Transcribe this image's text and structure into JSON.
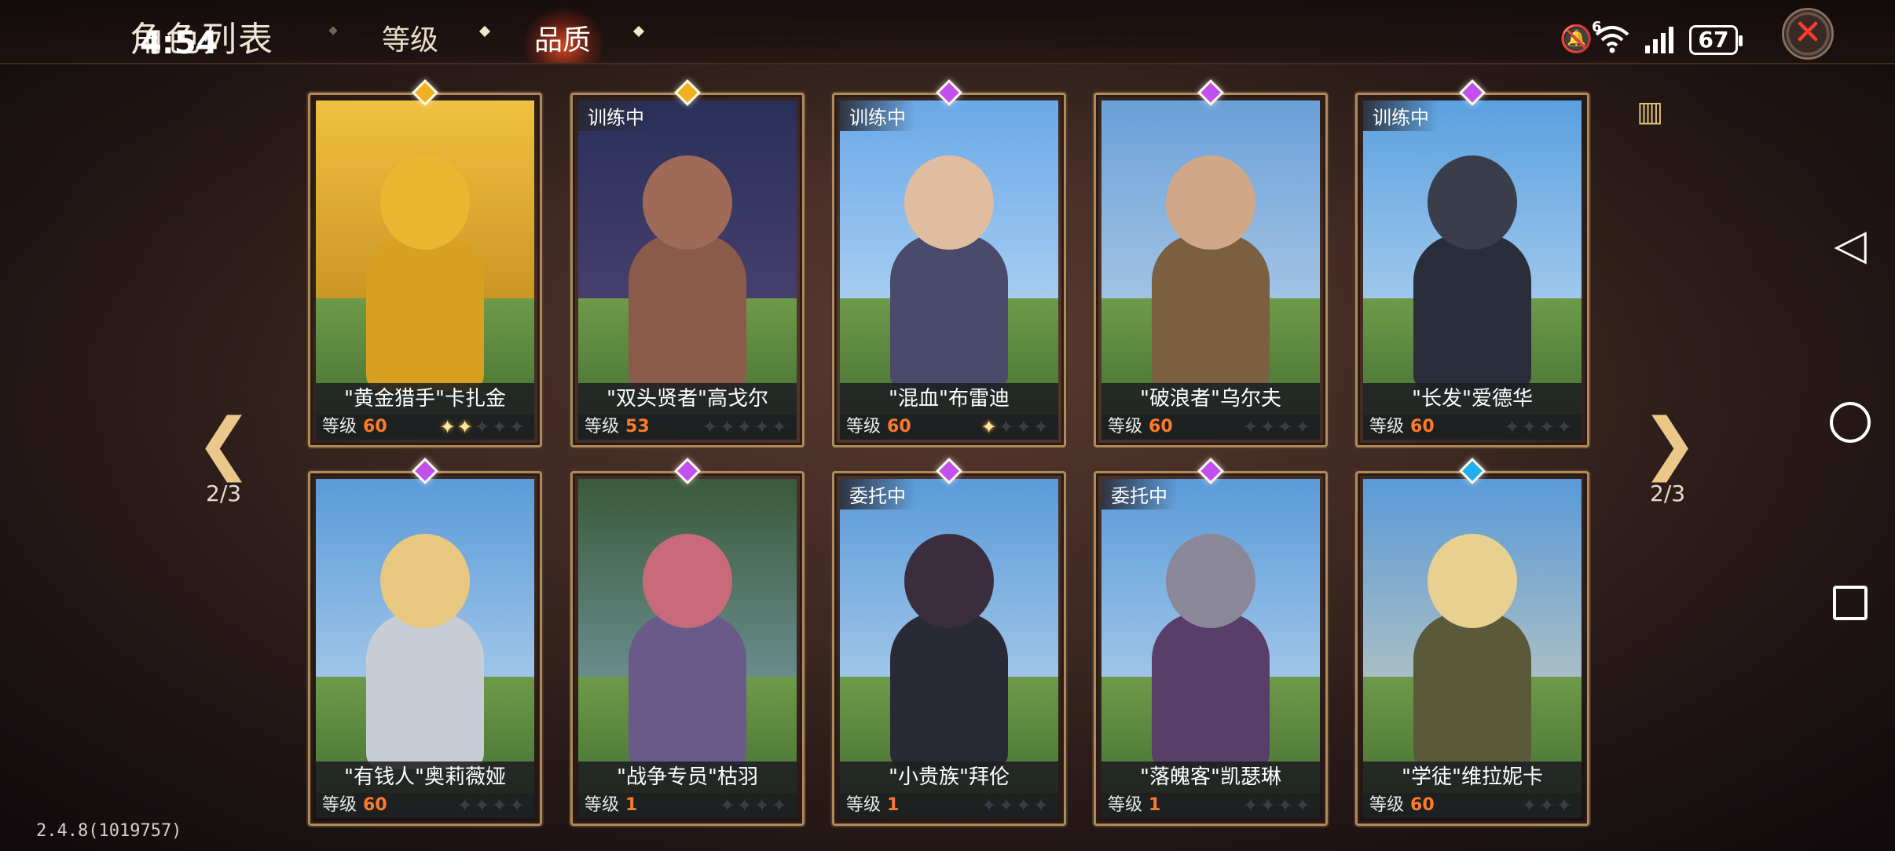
{
  "header": {
    "title": "角色列表",
    "clock": "4:54",
    "tabs": [
      {
        "label": "等级",
        "active": false
      },
      {
        "label": "品质",
        "active": true
      }
    ],
    "battery": "67",
    "signal_label": "6"
  },
  "pagination": {
    "left": "2/3",
    "right": "2/3"
  },
  "version": "2.4.8(1019757)",
  "cards": [
    {
      "name": "\"黄金猎手\"卡扎金",
      "badge": "",
      "level_label": "等级",
      "level": "60",
      "stars_on": 2,
      "stars_total": 5,
      "gem_color": "#f0b020"
    },
    {
      "name": "\"双头贤者\"高戈尔",
      "badge": "训练中",
      "level_label": "等级",
      "level": "53",
      "stars_on": 0,
      "stars_total": 5,
      "gem_color": "#f0b020"
    },
    {
      "name": "\"混血\"布雷迪",
      "badge": "训练中",
      "level_label": "等级",
      "level": "60",
      "stars_on": 1,
      "stars_total": 4,
      "gem_color": "#c050f0"
    },
    {
      "name": "\"破浪者\"乌尔夫",
      "badge": "",
      "level_label": "等级",
      "level": "60",
      "stars_on": 0,
      "stars_total": 4,
      "gem_color": "#c050f0"
    },
    {
      "name": "\"长发\"爱德华",
      "badge": "训练中",
      "level_label": "等级",
      "level": "60",
      "stars_on": 0,
      "stars_total": 4,
      "gem_color": "#c050f0"
    },
    {
      "name": "\"有钱人\"奥莉薇娅",
      "badge": "",
      "level_label": "等级",
      "level": "60",
      "stars_on": 0,
      "stars_total": 4,
      "gem_color": "#c050f0"
    },
    {
      "name": "\"战争专员\"枯羽",
      "badge": "",
      "level_label": "等级",
      "level": "1",
      "stars_on": 0,
      "stars_total": 4,
      "gem_color": "#c050f0"
    },
    {
      "name": "\"小贵族\"拜伦",
      "badge": "委托中",
      "level_label": "等级",
      "level": "1",
      "stars_on": 0,
      "stars_total": 4,
      "gem_color": "#c050f0"
    },
    {
      "name": "\"落魄客\"凯瑟琳",
      "badge": "委托中",
      "level_label": "等级",
      "level": "1",
      "stars_on": 0,
      "stars_total": 4,
      "gem_color": "#c050f0"
    },
    {
      "name": "\"学徒\"维拉妮卡",
      "badge": "",
      "level_label": "等级",
      "level": "60",
      "stars_on": 0,
      "stars_total": 3,
      "gem_color": "#20b0f0"
    }
  ],
  "icons": {
    "close": "close-icon",
    "arrow_left": "arrow-left-icon",
    "arrow_right": "arrow-right-icon",
    "list": "list-view-icon",
    "nav_back": "back-icon",
    "nav_home": "home-icon",
    "nav_recent": "recent-apps-icon"
  }
}
